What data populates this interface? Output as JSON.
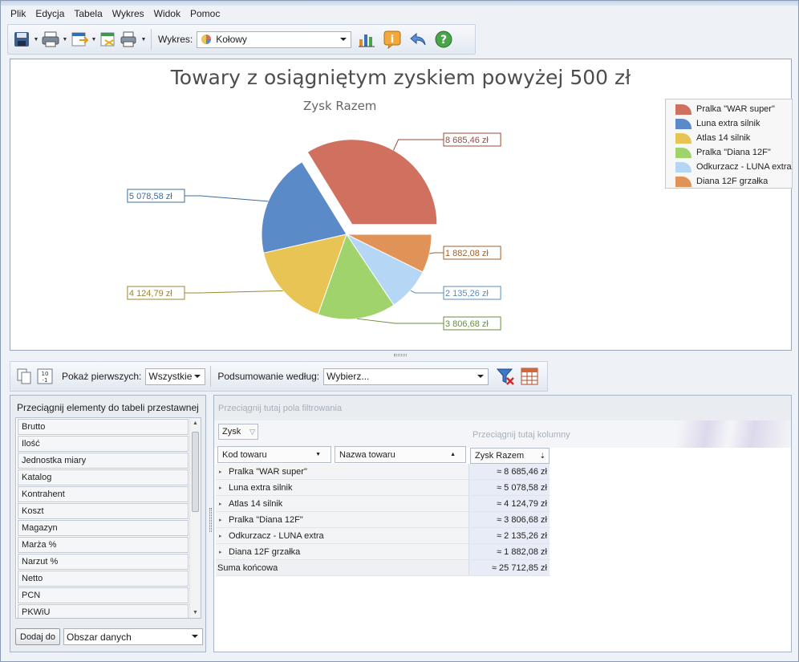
{
  "menu": [
    "Plik",
    "Edycja",
    "Tabela",
    "Wykres",
    "Widok",
    "Pomoc"
  ],
  "toolbar": {
    "chart_label": "Wykres:",
    "chart_type": "Kołowy",
    "icons": [
      "save-icon",
      "print-icon",
      "export-icon",
      "export-data-icon",
      "print-preview-icon",
      "chart-wizard-icon",
      "info-icon",
      "undo-icon",
      "help-icon"
    ]
  },
  "chart_data": {
    "type": "pie",
    "title": "Towary z osiągniętym zyskiem powyżej 500 zł",
    "subtitle": "Zysk Razem",
    "categories": [
      "Pralka \"WAR super\"",
      "Luna extra silnik",
      "Atlas 14 silnik",
      "Pralka \"Diana 12F\"",
      "Odkurzacz - LUNA extra",
      "Diana 12F grzałka"
    ],
    "values": [
      8685.46,
      5078.58,
      4124.79,
      3806.68,
      2135.26,
      1882.08
    ],
    "labels": [
      "8 685,46 zł",
      "5 078,58 zł",
      "4 124,79 zł",
      "3 806,68 zł",
      "2 135,26 zł",
      "1 882,08 zł"
    ],
    "colors": [
      "#d0705e",
      "#5b8ac9",
      "#e8c454",
      "#a0d36b",
      "#b6d6f5",
      "#e09257"
    ],
    "label_colors": [
      "#9b4a3a",
      "#3b6b9c",
      "#9b8630",
      "#6a8e3d",
      "#5e8bb5",
      "#a15f2a"
    ],
    "exploded": [
      true,
      false,
      false,
      false,
      false,
      false
    ],
    "legend_position": "top-right"
  },
  "pivot_toolbar": {
    "show_first_label": "Pokaż pierwszych:",
    "show_first_value": "Wszystkie",
    "summary_label": "Podsumowanie według:",
    "summary_value": "Wybierz..."
  },
  "field_panel": {
    "title": "Przeciągnij elementy do tabeli przestawnej",
    "fields": [
      "Brutto",
      "Ilość",
      "Jednostka miary",
      "Katalog",
      "Kontrahent",
      "Koszt",
      "Magazyn",
      "Marża %",
      "Narzut %",
      "Netto",
      "PCN",
      "PKWiU"
    ],
    "add_button": "Dodaj do",
    "target_area": "Obszar danych"
  },
  "pivot": {
    "filter_drop": "Przeciągnij tutaj pola filtrowania",
    "data_field": "Zysk",
    "column_drop": "Przeciągnij tutaj kolumny",
    "row_fields": [
      "Kod towaru",
      "Nazwa towaru"
    ],
    "value_header": "Zysk Razem",
    "rows": [
      {
        "name": "Pralka \"WAR super\"",
        "value": "≈ 8 685,46 zł"
      },
      {
        "name": "Luna extra silnik",
        "value": "≈ 5 078,58 zł"
      },
      {
        "name": "Atlas 14 silnik",
        "value": "≈ 4 124,79 zł"
      },
      {
        "name": "Pralka \"Diana 12F\"",
        "value": "≈ 3 806,68 zł"
      },
      {
        "name": "Odkurzacz - LUNA extra",
        "value": "≈ 2 135,26 zł"
      },
      {
        "name": "Diana 12F grzałka",
        "value": "≈ 1 882,08 zł"
      }
    ],
    "total_label": "Suma końcowa",
    "total_value": "≈ 25 712,85 zł"
  }
}
